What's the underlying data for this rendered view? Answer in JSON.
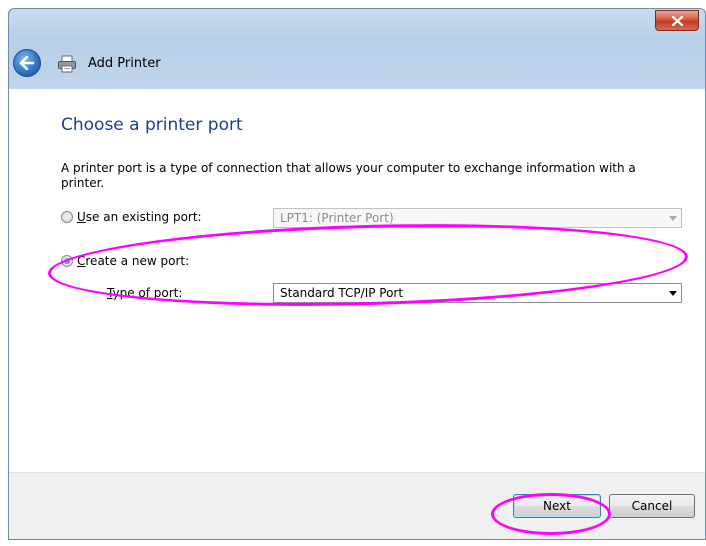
{
  "window": {
    "title": "Add Printer",
    "close_icon": "close-icon",
    "back_icon": "back-arrow-icon",
    "printer_icon": "printer-icon"
  },
  "page": {
    "title": "Choose a printer port",
    "description": "A printer port is a type of connection that allows your computer to exchange information with a printer."
  },
  "options": {
    "existing": {
      "label": "Use an existing port:",
      "selected": false,
      "value": "LPT1: (Printer Port)",
      "disabled": true
    },
    "new_port": {
      "label": "Create a new port:",
      "selected": true
    },
    "type_of_port": {
      "label": "Type of port:",
      "value": "Standard TCP/IP Port"
    }
  },
  "buttons": {
    "next": "Next",
    "cancel": "Cancel"
  },
  "annotations": {
    "highlight_color": "#ff00ff"
  }
}
